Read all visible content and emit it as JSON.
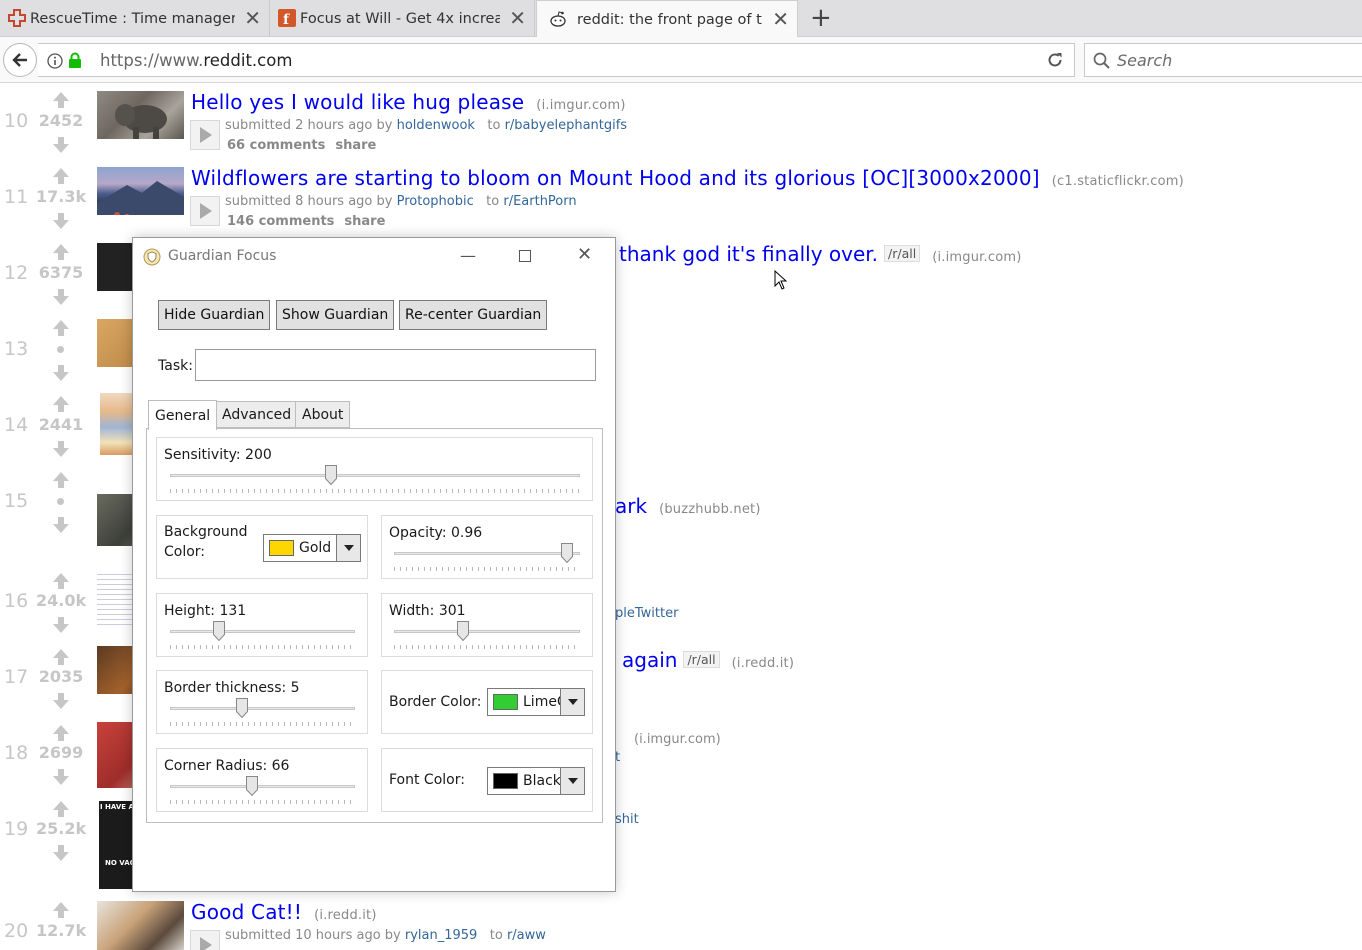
{
  "browser": {
    "tabs": [
      {
        "title": "RescueTime : Time manager",
        "icon": "rescuetime-icon",
        "active": false
      },
      {
        "title": "Focus at Will - Get 4x increa",
        "icon": "focusatwill-icon",
        "active": false
      },
      {
        "title": "reddit: the front page of the",
        "icon": "reddit-icon",
        "active": true
      }
    ],
    "url_prefix": "https://www.",
    "url_host": "reddit.com",
    "search_placeholder": "Search"
  },
  "posts": [
    {
      "rank": "10",
      "score": "2452",
      "title": "Hello yes I would like hug please",
      "domain": "(i.imgur.com)",
      "submitted": "submitted 2 hours ago by",
      "author": "holdenwook",
      "to": "to",
      "subreddit": "r/babyelephantgifs",
      "comments": "66 comments",
      "share": "share"
    },
    {
      "rank": "11",
      "score": "17.3k",
      "title": "Wildflowers are starting to bloom on Mount Hood and its glorious [OC][3000x2000]",
      "domain": "(c1.staticflickr.com)",
      "submitted": "submitted 8 hours ago by",
      "author": "Protophobic",
      "to": "to",
      "subreddit": "r/EarthPorn",
      "comments": "146 comments",
      "share": "share"
    },
    {
      "rank": "12",
      "score": "6375",
      "title_fragment": "thank god it's finally over.",
      "flair": "/r/all",
      "domain": "(i.imgur.com)"
    },
    {
      "rank": "13",
      "score": ""
    },
    {
      "rank": "14",
      "score": "2441"
    },
    {
      "rank": "15",
      "score": "",
      "title_fragment": "ark",
      "domain": "(buzzhubb.net)"
    },
    {
      "rank": "16",
      "score": "24.0k",
      "sub_fragment": "pleTwitter"
    },
    {
      "rank": "17",
      "score": "2035",
      "title_fragment": "again",
      "flair": "/r/all",
      "domain": "(i.redd.it)"
    },
    {
      "rank": "18",
      "score": "2699",
      "domain": "(i.imgur.com)",
      "sub_fragment": "t"
    },
    {
      "rank": "19",
      "score": "25.2k",
      "sub_fragment": "shit",
      "thumb_text_top": "I HAVE AN I",
      "thumb_text_bottom": "NO VACC"
    },
    {
      "rank": "20",
      "score": "12.7k",
      "title": "Good Cat!!",
      "domain": "(i.redd.it)",
      "submitted": "submitted 10 hours ago by",
      "author": "rylan_1959",
      "to": "to",
      "subreddit": "r/aww"
    }
  ],
  "guardian": {
    "title": "Guardian Focus",
    "buttons": {
      "hide": "Hide Guardian",
      "show": "Show Guardian",
      "recenter": "Re-center Guardian"
    },
    "task_label": "Task:",
    "task_value": "",
    "tabs": [
      "General",
      "Advanced",
      "About"
    ],
    "active_tab": "General",
    "sensitivity": {
      "label": "Sensitivity: 200",
      "value": 200,
      "fraction": 0.39
    },
    "background_color": {
      "label_line1": "Background",
      "label_line2": "Color:",
      "value": "Gold",
      "swatch": "#FFD700"
    },
    "opacity": {
      "label": "Opacity: 0.96",
      "value": 0.96,
      "fraction": 0.96
    },
    "height": {
      "label": "Height: 131",
      "value": 131,
      "fraction": 0.25
    },
    "width": {
      "label": "Width: 301",
      "value": 301,
      "fraction": 0.36
    },
    "border_thickness": {
      "label": "Border thickness: 5",
      "value": 5,
      "fraction": 0.38
    },
    "border_color": {
      "label": "Border Color:",
      "value": "LimeG",
      "swatch": "#32CD32"
    },
    "corner_radius": {
      "label": "Corner Radius: 66",
      "value": 66,
      "fraction": 0.44
    },
    "font_color": {
      "label": "Font Color:",
      "value": "Black",
      "swatch": "#000000"
    }
  }
}
